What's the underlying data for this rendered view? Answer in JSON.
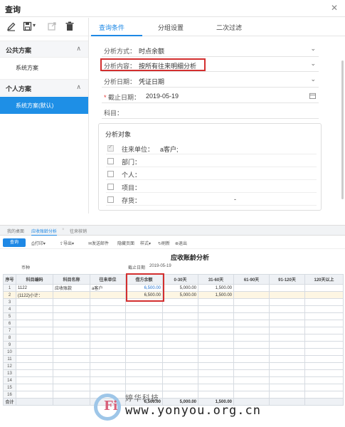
{
  "dialog": {
    "title": "查询",
    "close_icon": "close-icon",
    "toolbar_icons": [
      "edit-icon",
      "save-icon",
      "export-icon",
      "delete-icon"
    ],
    "groups": [
      {
        "label": "公共方案",
        "items": [
          "系统方案"
        ]
      },
      {
        "label": "个人方案",
        "items": [
          "系统方案(默认)"
        ]
      }
    ],
    "tabs": [
      "查询条件",
      "分组设置",
      "二次过滤"
    ],
    "fields": {
      "method_label": "分析方式：",
      "method_value": "时点余额",
      "content_label": "分析内容：",
      "content_value": "按所有往来明细分析",
      "date_label": "分析日期：",
      "date_value": "凭证日期",
      "deadline_label": "截止日期：",
      "deadline_value": "2019-05-19",
      "subject_label": "科目："
    },
    "object_box": {
      "title": "分析对象",
      "rows": [
        {
          "label": "往来单位：",
          "value": "a客户;",
          "checked": true
        },
        {
          "label": "部门：",
          "value": "",
          "checked": false
        },
        {
          "label": "个人：",
          "value": "",
          "checked": false
        },
        {
          "label": "项目：",
          "value": "",
          "checked": false
        },
        {
          "label": "存货：",
          "value": "-",
          "checked": false
        }
      ]
    }
  },
  "report": {
    "tabs": [
      "我的桌面",
      "应收账龄分析",
      "往来核销"
    ],
    "toolbar": {
      "query": "查询",
      "buttons": [
        "打印",
        "导出",
        "发送邮件",
        "隐藏页面",
        "样式",
        "刷新",
        "退出"
      ]
    },
    "title": "应收账龄分析",
    "currency_label": "币种",
    "deadline_label": "截止日期",
    "deadline_value": "2019-05-19",
    "columns": [
      "序号",
      "科目编码",
      "科目名称",
      "往来单位",
      "借方余额",
      "0-30天",
      "31-60天",
      "61-90天",
      "91-120天",
      "120天以上"
    ],
    "rows": [
      {
        "no": "1",
        "code": "1122",
        "name": "应收账款",
        "unit": "a客户",
        "balance": "6,500.00",
        "d30": "5,000.00",
        "d60": "1,500.00",
        "d90": "",
        "d120": "",
        "over": ""
      },
      {
        "no": "2",
        "code": "(1122)小计：",
        "name": "",
        "unit": "",
        "balance": "6,500.00",
        "d30": "5,000.00",
        "d60": "1,500.00",
        "d90": "",
        "d120": "",
        "over": ""
      }
    ],
    "empty_rows": [
      "3",
      "4",
      "5",
      "6",
      "7",
      "8",
      "9",
      "10",
      "11",
      "12",
      "13",
      "14",
      "15",
      "16"
    ],
    "total": {
      "label": "合计",
      "balance": "6,500.00",
      "d30": "5,000.00",
      "d60": "1,500.00"
    },
    "watermark": {
      "logo_text": "Fi",
      "cn": "婷华科技",
      "url": "www.yonyou.org.cn"
    }
  }
}
